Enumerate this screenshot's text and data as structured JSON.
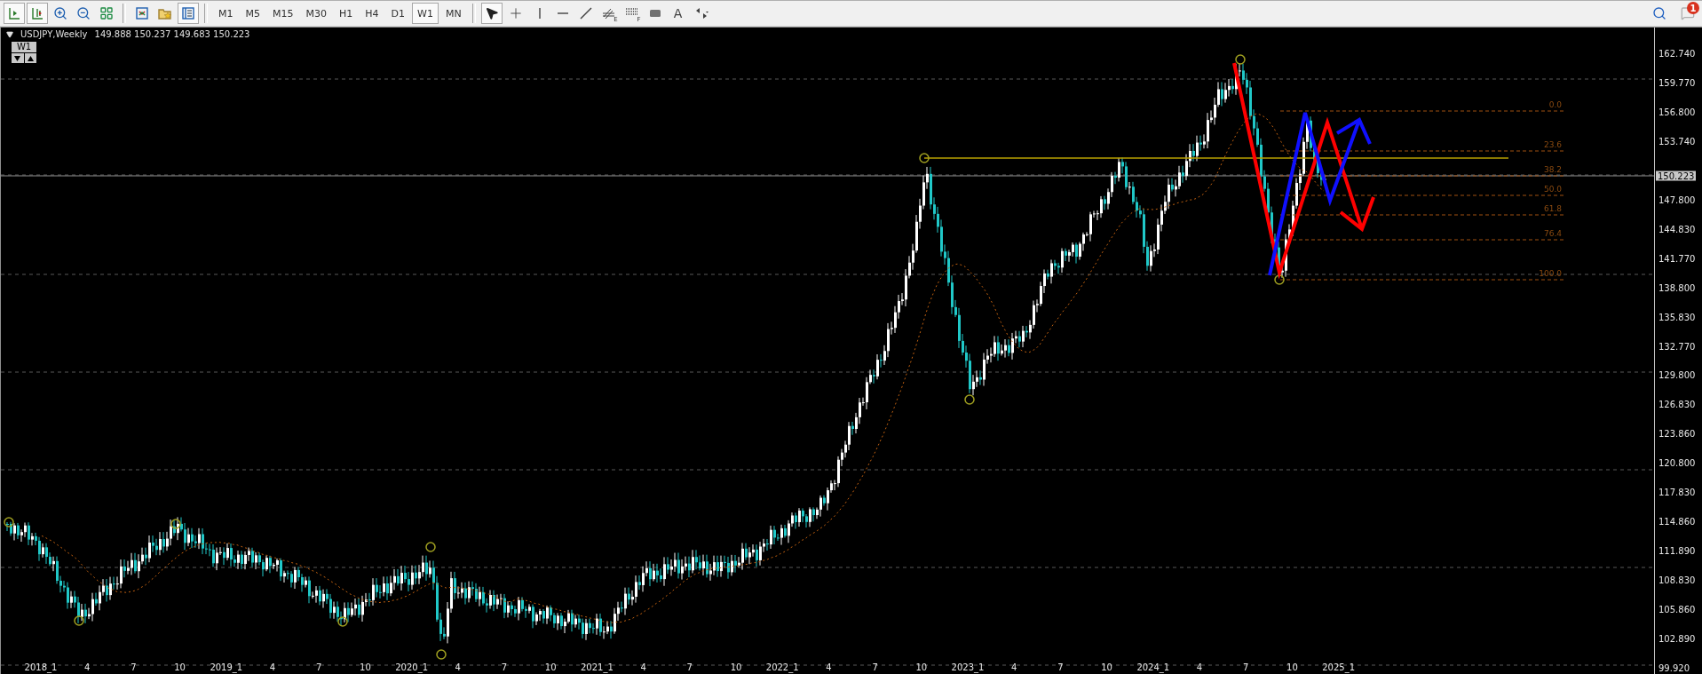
{
  "toolbar": {
    "chart_buttons": [
      {
        "kind": "chart-shift",
        "selected": true
      },
      {
        "kind": "autoscroll",
        "selected": true
      },
      {
        "kind": "zoom-in",
        "selected": false
      },
      {
        "kind": "zoom-out",
        "selected": false
      },
      {
        "kind": "tile",
        "selected": false
      }
    ],
    "window_buttons": [
      {
        "kind": "indicators",
        "selected": false
      },
      {
        "kind": "templates",
        "selected": false
      },
      {
        "kind": "navigator",
        "selected": true
      }
    ],
    "timeframes": [
      {
        "label": "M1",
        "selected": false
      },
      {
        "label": "M5",
        "selected": false
      },
      {
        "label": "M15",
        "selected": false
      },
      {
        "label": "M30",
        "selected": false
      },
      {
        "label": "H1",
        "selected": false
      },
      {
        "label": "H4",
        "selected": false
      },
      {
        "label": "D1",
        "selected": false
      },
      {
        "label": "W1",
        "selected": true
      },
      {
        "label": "MN",
        "selected": false
      }
    ],
    "tools": [
      {
        "kind": "cursor",
        "selected": true
      },
      {
        "kind": "crosshair",
        "selected": false
      },
      {
        "kind": "vline",
        "selected": false
      },
      {
        "kind": "hline",
        "selected": false
      },
      {
        "kind": "trendline",
        "selected": false
      },
      {
        "kind": "fibo-channel",
        "label": "E",
        "selected": false
      },
      {
        "kind": "fibo-lines",
        "label": "F",
        "selected": false
      },
      {
        "kind": "rectangle",
        "selected": false
      },
      {
        "kind": "text",
        "label": "A",
        "selected": false
      },
      {
        "kind": "arrows",
        "selected": false
      }
    ],
    "notifications": {
      "count": "1"
    }
  },
  "chart": {
    "symbol": "USDJPY,Weekly",
    "ohlc": "149.888 150.237 149.683 150.223",
    "period_badge": "W1",
    "price_axis": {
      "labels": [
        "162.740",
        "159.770",
        "156.800",
        "153.740",
        "147.800",
        "144.830",
        "141.770",
        "138.800",
        "135.830",
        "132.770",
        "129.800",
        "126.830",
        "123.860",
        "120.800",
        "117.830",
        "114.860",
        "111.890",
        "108.830",
        "105.860",
        "102.890",
        "99.920"
      ],
      "current_price": "150.223"
    },
    "time_axis": [
      "2018_1",
      "4",
      "7",
      "10",
      "2019_1",
      "4",
      "7",
      "10",
      "2020_1",
      "4",
      "7",
      "10",
      "2021_1",
      "4",
      "7",
      "10",
      "2022_1",
      "4",
      "7",
      "10",
      "2023_1",
      "4",
      "7",
      "10",
      "2024_1",
      "4",
      "7",
      "10",
      "2025_1"
    ],
    "fib_levels": [
      "0.0",
      "23.6",
      "38.2",
      "50.0",
      "61.8",
      "76.4",
      "100.0"
    ]
  }
}
